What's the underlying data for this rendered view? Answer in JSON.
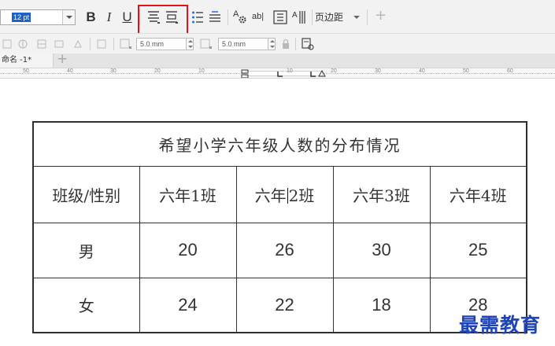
{
  "toolbar": {
    "font_size_value": "12 pt",
    "bold_label": "B",
    "italic_label": "I",
    "underline_label": "U",
    "char_format_label": "A",
    "text_field_label": "ab|",
    "page_margin_label": "页边距",
    "add_label": "+",
    "icons": [
      "align-top-icon",
      "align-middle-icon",
      "list-icon",
      "paragraph-icon",
      "char-format-icon",
      "text-field-icon",
      "text-box-icon",
      "vertical-text-icon"
    ]
  },
  "toolbar2": {
    "width_value": "5.0 mm",
    "height_value": "5.0 mm"
  },
  "tabs": {
    "active_label": "命名 -1*",
    "add_label": "+"
  },
  "ruler": {
    "labels": [
      "50",
      "40",
      "30",
      "20",
      "10",
      "10",
      "20",
      "30",
      "40",
      "50",
      "60"
    ]
  },
  "document": {
    "table": {
      "title": "希望小学六年级人数的分布情况",
      "header": [
        "班级/性别",
        "六年1班",
        "六年",
        "2班",
        "六年3班",
        "六年4班"
      ],
      "rows": [
        {
          "label": "男",
          "values": [
            "20",
            "26",
            "30",
            "25"
          ]
        },
        {
          "label": "女",
          "values": [
            "24",
            "22",
            "18",
            "28"
          ]
        }
      ]
    }
  },
  "watermark": "最需教育",
  "colors": {
    "highlight_box": "#e0141c",
    "selection": "#1e62c8",
    "watermark": "#1e44b8"
  }
}
